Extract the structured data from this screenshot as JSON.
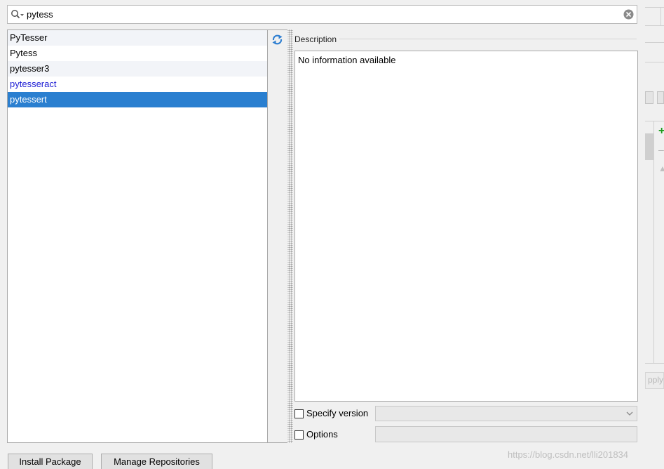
{
  "search": {
    "query": "pytess"
  },
  "packages": [
    {
      "name": "PyTesser",
      "state": "normal"
    },
    {
      "name": "Pytess",
      "state": "normal"
    },
    {
      "name": "pytesser3",
      "state": "normal"
    },
    {
      "name": "pytesseract",
      "state": "link"
    },
    {
      "name": "pytessert",
      "state": "selected"
    }
  ],
  "description": {
    "label": "Description",
    "text": "No information available"
  },
  "options": {
    "specify_version_label": "Specify version",
    "options_label": "Options"
  },
  "buttons": {
    "install": "Install Package",
    "manage": "Manage Repositories"
  },
  "watermark": "https://blog.csdn.net/lli201834",
  "colors": {
    "selection": "#2a7fd0",
    "link": "#1d1dd4",
    "add_icon": "#1a9a1a"
  }
}
